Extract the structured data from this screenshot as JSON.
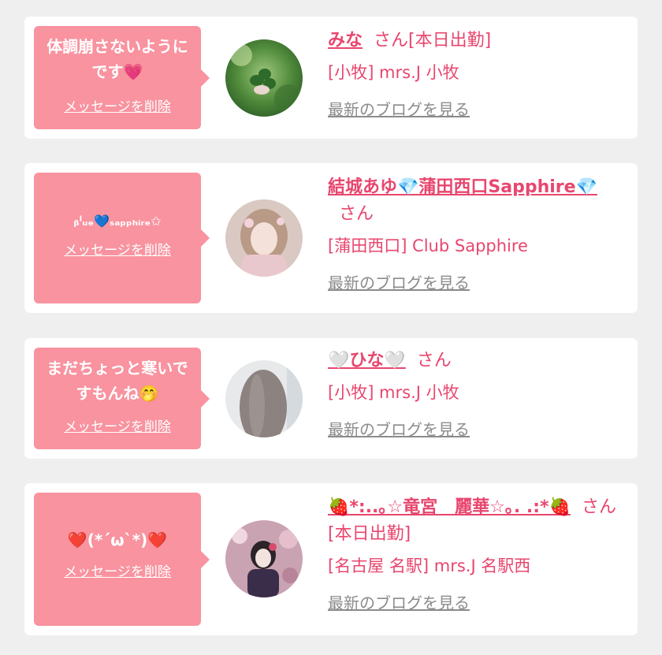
{
  "cards": [
    {
      "message": "体調崩さないようにです💗",
      "delete_label": "メッセージを削除",
      "name": "みな",
      "san": "さん",
      "status": "[本日出勤]",
      "shop": "[小牧] mrs.J 小牧",
      "blog_label": "最新のブログを見る"
    },
    {
      "message": "ᵦˡᵤₑ💙ₛₐₚₚₕᵢᵣₑ✩",
      "delete_label": "メッセージを削除",
      "name": "結城あゆ💎蒲田西口Sapphire💎",
      "san": "さん",
      "status": "",
      "shop": "[蒲田西口] Club Sapphire",
      "blog_label": "最新のブログを見る"
    },
    {
      "message": "まだちょっと寒いですもんね🤭",
      "delete_label": "メッセージを削除",
      "name": "🤍ひな🤍",
      "san": "さん",
      "status": "",
      "shop": "[小牧] mrs.J 小牧",
      "blog_label": "最新のブログを見る"
    },
    {
      "message": "❤️(*´ω`*)❤️",
      "delete_label": "メッセージを削除",
      "name": "🍓*:..｡☆竜宮　麗華☆｡. .:*🍓",
      "san": "さん",
      "status": "[本日出勤]",
      "shop": "[名古屋 名駅] mrs.J 名駅西",
      "blog_label": "最新のブログを見る"
    }
  ],
  "colors": {
    "background": "#efefef",
    "card": "#ffffff",
    "bubble": "#f8939f",
    "accent": "#e8466e",
    "muted": "#8b8b8b"
  }
}
